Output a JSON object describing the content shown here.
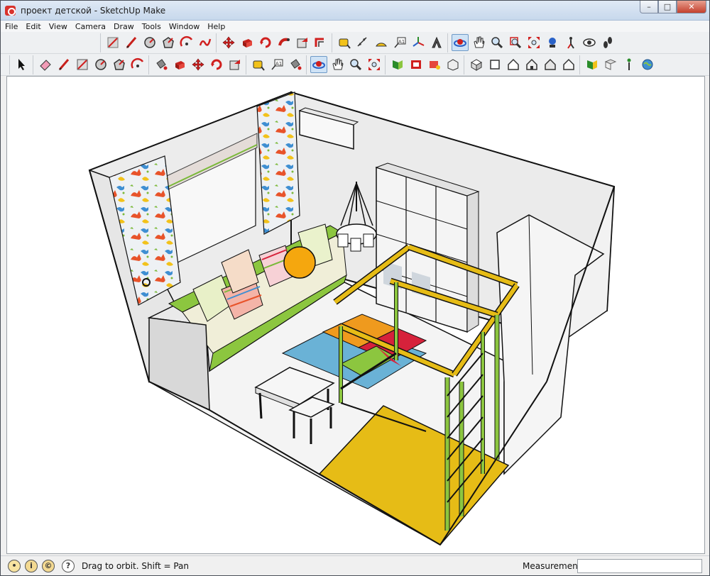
{
  "window": {
    "title": "проект детской - SketchUp Make",
    "controls": {
      "minimize": "–",
      "maximize": "□",
      "close": "✕"
    }
  },
  "menu": [
    "File",
    "Edit",
    "View",
    "Camera",
    "Draw",
    "Tools",
    "Window",
    "Help"
  ],
  "toolbar_row1": [
    [
      "line-tool-icon",
      "pencil-tool-icon",
      "circle-tool-icon",
      "polygon-tool-icon",
      "arc-tool-icon",
      "freehand-tool-icon"
    ],
    [
      "move-tool-icon",
      "push-pull-tool-icon",
      "rotate-tool-icon",
      "follow-me-tool-icon",
      "scale-tool-icon",
      "offset-tool-icon"
    ],
    [
      "tape-measure-icon",
      "dimension-tool-icon",
      "protractor-tool-icon",
      "text-tool-icon",
      "axes-tool-icon",
      "3d-text-icon"
    ],
    [
      "orbit-tool-icon",
      "pan-tool-icon",
      "zoom-tool-icon",
      "zoom-window-icon",
      "zoom-extents-icon",
      "position-camera-icon",
      "walk-tool-icon",
      "look-around-icon",
      "footprints-icon"
    ]
  ],
  "toolbar_row2": [
    [
      "select-tool-icon"
    ],
    [
      "eraser-tool-icon",
      "pencil-tool-icon",
      "rectangle-tool-icon",
      "circle-tool-icon",
      "polygon-tool-icon",
      "arc-tool-icon"
    ],
    [
      "paint-bucket-icon",
      "push-pull-tool-icon",
      "move-tool-icon",
      "rotate-tool-icon",
      "scale-tool-icon"
    ],
    [
      "tape-measure-icon",
      "text-tool-icon",
      "paint-bucket-icon"
    ],
    [
      "orbit-tool-icon",
      "pan-tool-icon",
      "zoom-tool-icon",
      "zoom-extents-icon"
    ],
    [
      "previous-view-icon",
      "get-models-icon",
      "share-model-icon",
      "3d-warehouse-icon"
    ],
    [
      "iso-view-icon",
      "top-view-icon",
      "front-view-icon",
      "right-view-icon",
      "back-view-icon",
      "left-view-icon"
    ],
    [
      "extension-warehouse-icon",
      "xray-icon",
      "person-icon",
      "globe-icon"
    ]
  ],
  "active_tool": "orbit-tool-icon",
  "colors": {
    "wall": "#ededed",
    "wall_side": "#dcdcdc",
    "floor": "#f4f4f4",
    "accent_green": "#8cc63f",
    "accent_yellow": "#e6bc16",
    "mat_red": "#d6223b",
    "mat_blue": "#6ab2d6",
    "mat_orange": "#ef9a1e",
    "lamp": "#f5a70e"
  },
  "status": {
    "message": "Drag to orbit.  Shift = Pan",
    "measurements_label": "Measurements",
    "measurements_value": "",
    "help_icon": "?"
  }
}
